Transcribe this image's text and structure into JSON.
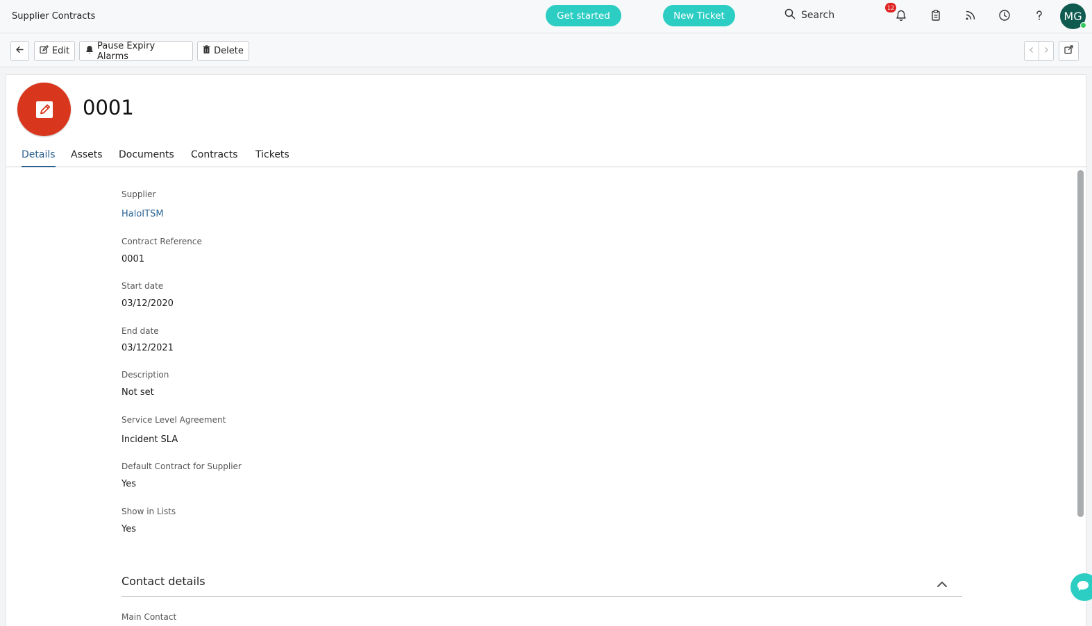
{
  "header": {
    "title": "Supplier Contracts",
    "get_started": "Get started",
    "new_ticket": "New Ticket",
    "search": "Search",
    "notification_count": "12",
    "avatar_initials": "MG"
  },
  "toolbar": {
    "edit": "Edit",
    "pause_alarms": "Pause Expiry Alarms",
    "delete": "Delete"
  },
  "record": {
    "title": "0001"
  },
  "tabs": [
    "Details",
    "Assets",
    "Documents",
    "Contracts",
    "Tickets"
  ],
  "details": [
    {
      "label": "Supplier",
      "value": "HaloITSM"
    },
    {
      "label": "Contract Reference",
      "value": "0001"
    },
    {
      "label": "Start date",
      "value": "03/12/2020"
    },
    {
      "label": "End date",
      "value": "03/12/2021"
    },
    {
      "label": "Description",
      "value": "Not set"
    },
    {
      "label": "Service Level Agreement",
      "value": "Incident SLA"
    },
    {
      "label": "Default Contract for Supplier",
      "value": "Yes"
    },
    {
      "label": "Show in Lists",
      "value": "Yes"
    }
  ],
  "contact_section": {
    "title": "Contact details",
    "first_label": "Main Contact"
  },
  "colors": {
    "accent_teal": "#2ccdc3",
    "record_icon_red": "#d9371d",
    "active_tab": "#2b5f8f",
    "avatar_bg": "#0f5b4f"
  }
}
